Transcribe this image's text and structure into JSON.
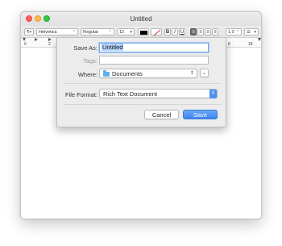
{
  "window": {
    "title": "Untitled"
  },
  "toolbar": {
    "paragraph_style": "¶",
    "font_family": "Helvetica",
    "font_style": "Regular",
    "font_size": "12",
    "text_color": "#000000",
    "bold_label": "B",
    "italic_label": "I",
    "underline_label": "U",
    "line_spacing": "1.0",
    "list_label": "☰"
  },
  "ruler": {
    "left_label": "0",
    "label_2": "2",
    "label_right_1": "8",
    "label_right_2": "18"
  },
  "save_dialog": {
    "save_as_label": "Save As:",
    "save_as_value": "Untitled",
    "tags_label": "Tags:",
    "tags_value": "",
    "where_label": "Where:",
    "where_value": "Documents",
    "file_format_label": "File Format:",
    "file_format_value": "Rich Text Document",
    "cancel_label": "Cancel",
    "save_label": "Save"
  },
  "colors": {
    "accent": "#3e86ef",
    "folder": "#5fb0ea",
    "close": "#fc605c",
    "minimize": "#fdbc40",
    "maximize": "#34c84a"
  }
}
